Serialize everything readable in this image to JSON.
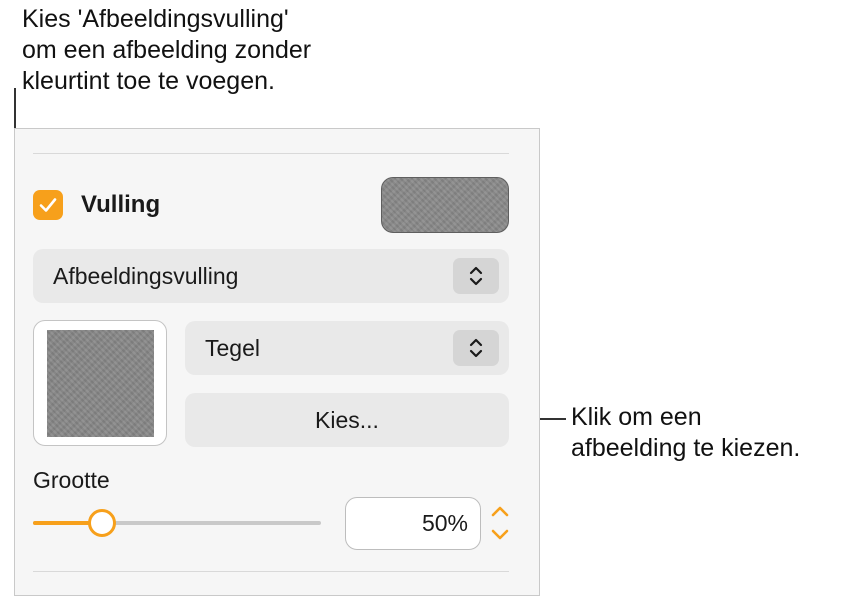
{
  "callouts": {
    "top_lines": [
      "Kies 'Afbeeldingsvulling'",
      "om een afbeelding zonder",
      "kleurtint toe te voegen."
    ],
    "right_lines": [
      "Klik om een",
      "afbeelding te kiezen."
    ]
  },
  "panel": {
    "fill": {
      "checked": true,
      "label": "Vulling",
      "checkbox_icon": "checkmark-icon",
      "swatch_color": "#8a8a8a"
    },
    "fill_type": {
      "selected": "Afbeeldingsvulling",
      "icon": "chevron-up-down-icon"
    },
    "image": {
      "preview_color": "#888888"
    },
    "scale_mode": {
      "selected": "Tegel",
      "icon": "chevron-up-down-icon"
    },
    "choose_button": {
      "label": "Kies..."
    },
    "size": {
      "label": "Grootte",
      "value_text": "50%",
      "slider_fraction": 0.24
    }
  },
  "colors": {
    "accent": "#f7a01b",
    "panel_bg": "#f6f6f6",
    "control_bg": "#e9e9e9"
  }
}
